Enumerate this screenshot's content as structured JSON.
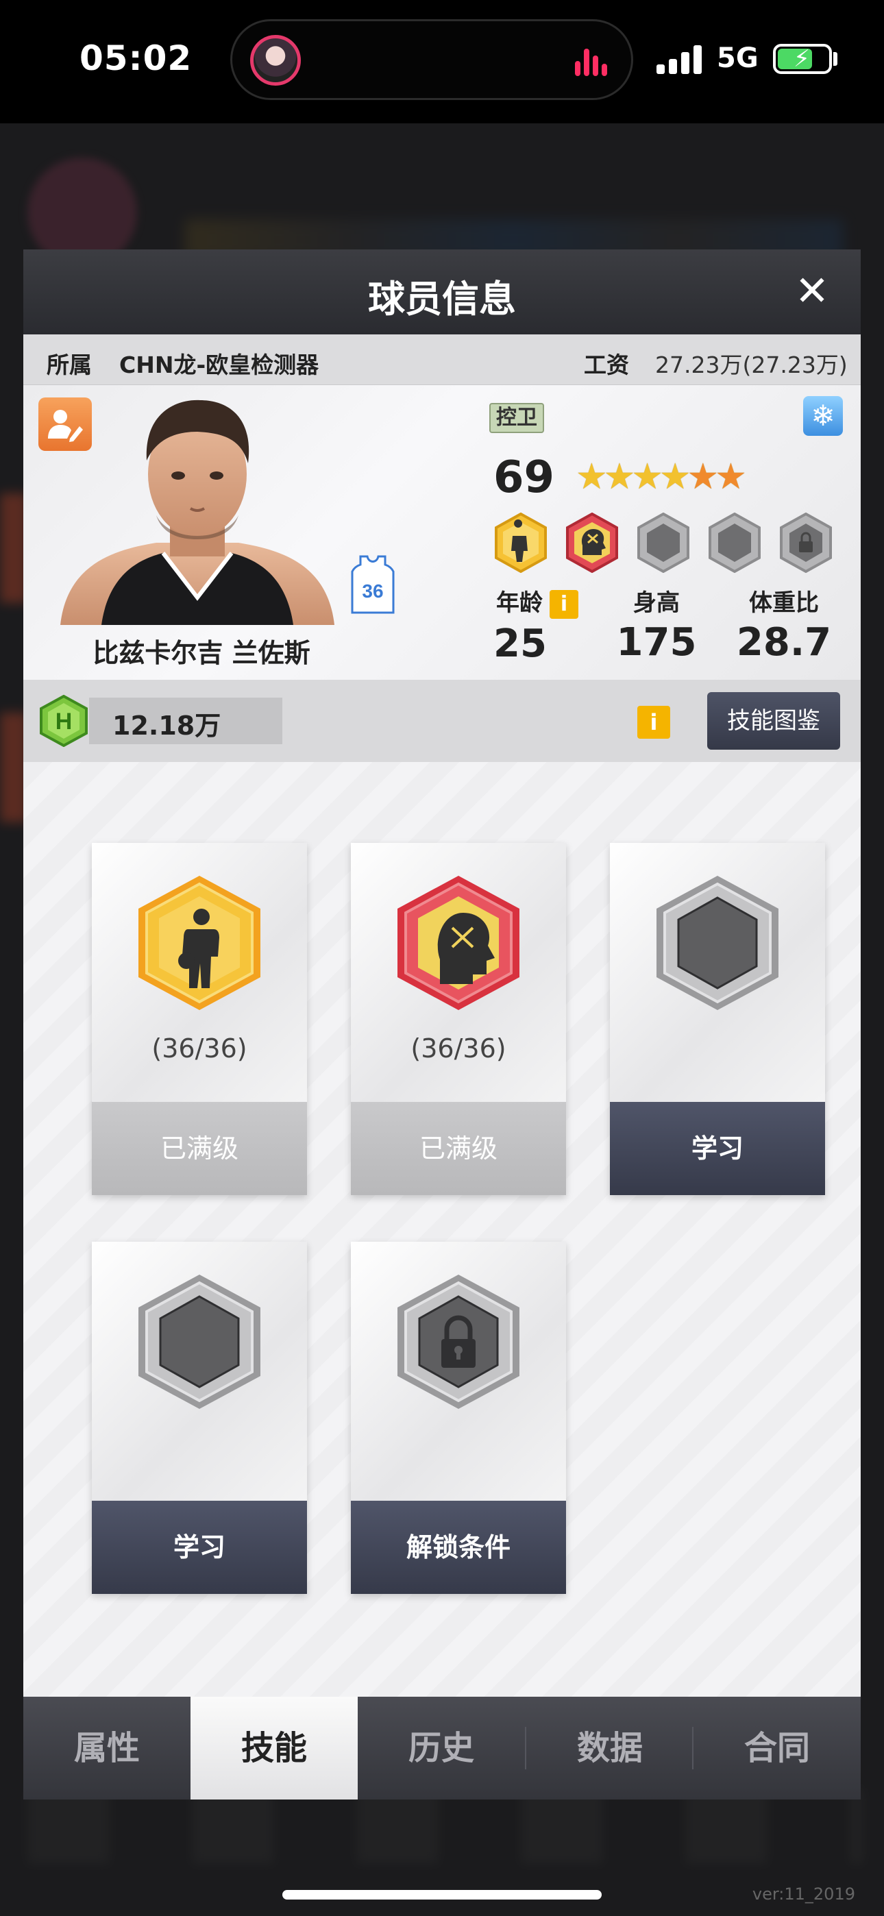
{
  "status_bar": {
    "time": "05:02",
    "network": "5G",
    "battery_level": 0.7,
    "charging": true
  },
  "modal": {
    "title": "球员信息",
    "close_icon": "close-icon"
  },
  "info_bar": {
    "team_label": "所属",
    "team_name": "CHN龙-欧皇检测器",
    "salary_label": "工资",
    "salary_value": "27.23万(27.23万)"
  },
  "player": {
    "name": "比兹卡尔吉 兰佐斯",
    "jersey_number": "36",
    "position": "控卫",
    "overall": "69",
    "stars": 5.5,
    "age_label": "年龄",
    "age": "25",
    "height_label": "身高",
    "height": "175",
    "bmi_label": "体重比",
    "bmi": "28.7",
    "info_glyph": "i"
  },
  "currency": {
    "coin_letter": "H",
    "amount": "12.18万",
    "info_glyph": "i",
    "skill_book_label": "技能图鉴"
  },
  "skills": [
    {
      "icon": "gold-player-skill-icon",
      "progress": "(36/36)",
      "action": "已满级",
      "state": "maxed"
    },
    {
      "icon": "red-head-skill-icon",
      "progress": "(36/36)",
      "action": "已满级",
      "state": "maxed"
    },
    {
      "icon": "empty-hex-icon",
      "progress": "",
      "action": "学习",
      "state": "active"
    },
    {
      "icon": "empty-hex-icon",
      "progress": "",
      "action": "学习",
      "state": "active"
    },
    {
      "icon": "locked-hex-icon",
      "progress": "",
      "action": "解锁条件",
      "state": "active"
    }
  ],
  "tabs": [
    {
      "label": "属性",
      "active": false
    },
    {
      "label": "技能",
      "active": true
    },
    {
      "label": "历史",
      "active": false
    },
    {
      "label": "数据",
      "active": false
    },
    {
      "label": "合同",
      "active": false
    }
  ],
  "footer": {
    "version": "ver:11_2019"
  },
  "colors": {
    "accent_dark": "#363a4a",
    "gold": "#f2c12e",
    "red_badge": "#e24a55",
    "info_yellow": "#f5b400"
  }
}
